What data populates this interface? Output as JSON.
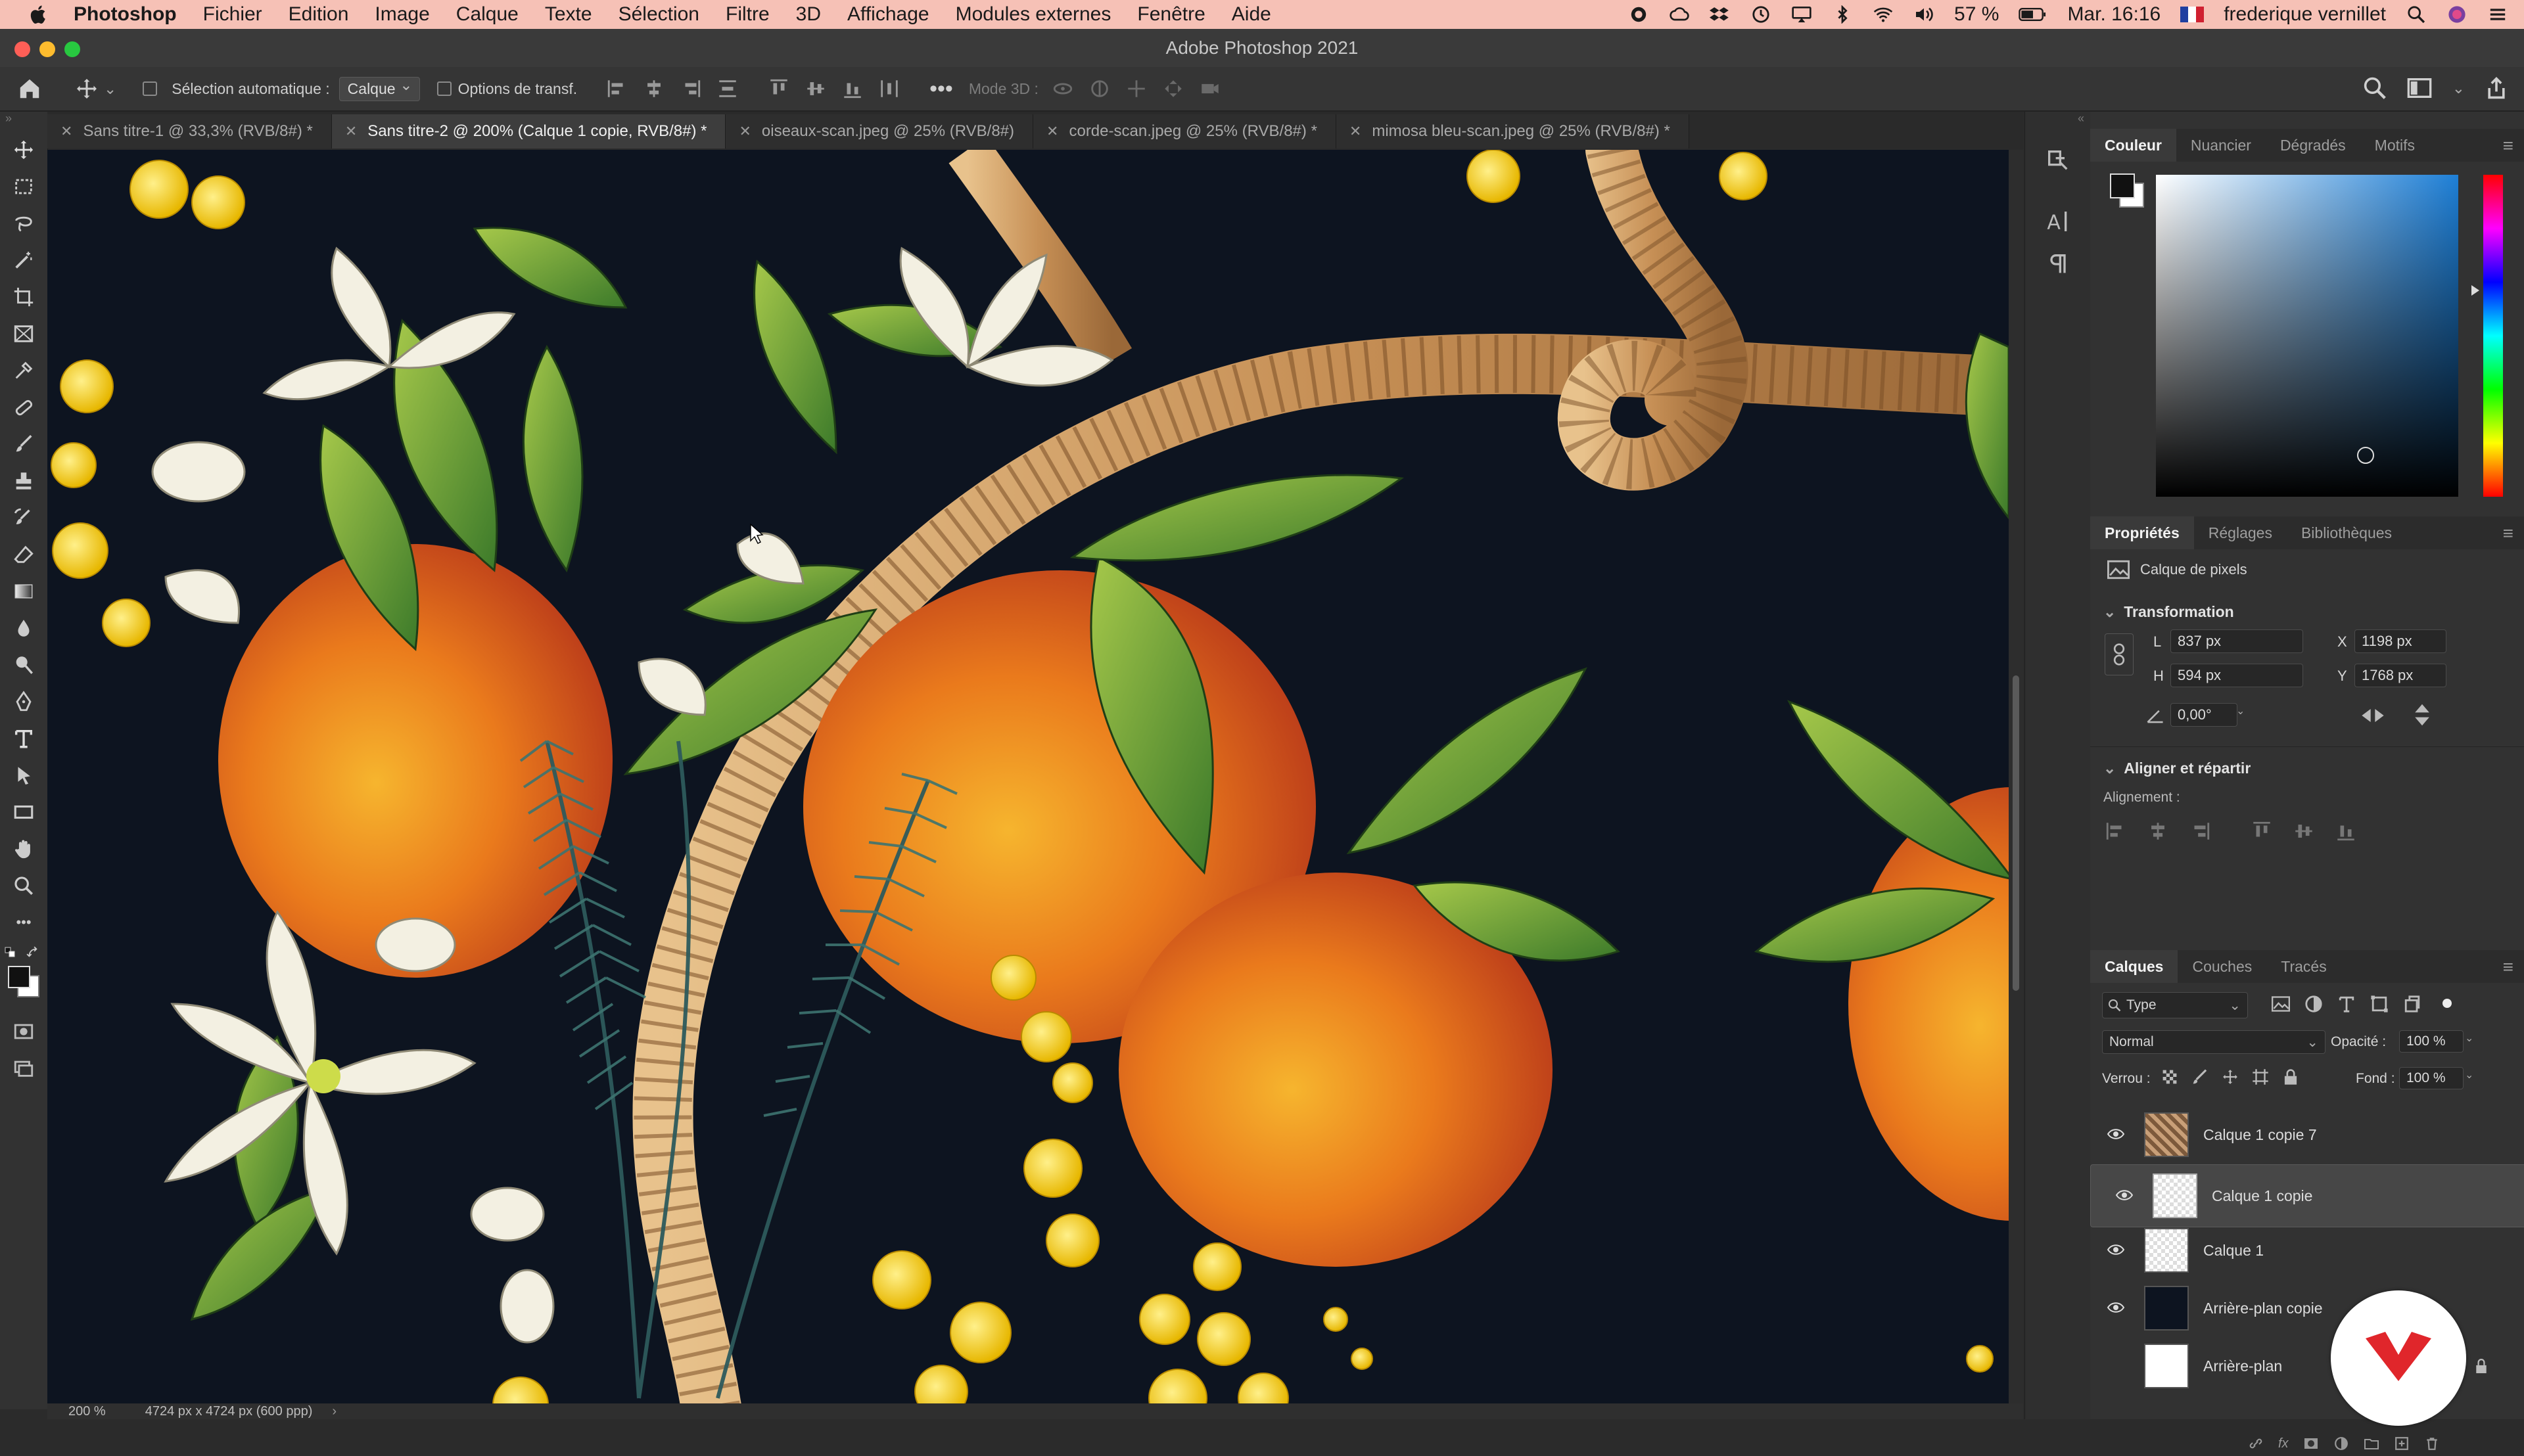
{
  "menubar": {
    "app": "Photoshop",
    "items": [
      "Fichier",
      "Edition",
      "Image",
      "Calque",
      "Texte",
      "Sélection",
      "Filtre",
      "3D",
      "Affichage",
      "Modules externes",
      "Fenêtre",
      "Aide"
    ],
    "battery": "57 %",
    "clock": "Mar. 16:16",
    "user": "frederique vernillet"
  },
  "window": {
    "title": "Adobe Photoshop 2021"
  },
  "options": {
    "auto_select_label": "Sélection automatique :",
    "auto_select_value": "Calque",
    "transform_label": "Options de transf.",
    "mode3d": "Mode 3D :"
  },
  "tabs": [
    {
      "label": "Sans titre-1 @ 33,3% (RVB/8#) *"
    },
    {
      "label": "Sans titre-2 @ 200% (Calque 1 copie, RVB/8#) *"
    },
    {
      "label": "oiseaux-scan.jpeg @ 25% (RVB/8#)"
    },
    {
      "label": "corde-scan.jpeg @ 25% (RVB/8#) *"
    },
    {
      "label": "mimosa bleu-scan.jpeg @ 25% (RVB/8#) *"
    }
  ],
  "status": {
    "zoom": "200 %",
    "doc_size": "4724 px x 4724 px (600 ppp)"
  },
  "color_panel": {
    "tabs": [
      "Couleur",
      "Nuancier",
      "Dégradés",
      "Motifs"
    ]
  },
  "properties": {
    "tabs": [
      "Propriétés",
      "Réglages",
      "Bibliothèques"
    ],
    "layer_kind": "Calque de pixels",
    "transform_title": "Transformation",
    "w_label": "L",
    "w_value": "837 px",
    "h_label": "H",
    "h_value": "594 px",
    "x_label": "X",
    "x_value": "1198 px",
    "y_label": "Y",
    "y_value": "1768 px",
    "angle": "0,00°",
    "align_title": "Aligner et répartir",
    "align_label": "Alignement :"
  },
  "layers_panel": {
    "tabs": [
      "Calques",
      "Couches",
      "Tracés"
    ],
    "filter": "Type",
    "blend_mode": "Normal",
    "opacity_label": "Opacité :",
    "opacity_value": "100 %",
    "lock_label": "Verrou :",
    "fill_label": "Fond :",
    "fill_value": "100 %",
    "layers": [
      {
        "name": "Calque 1 copie 7"
      },
      {
        "name": "Calque 1 copie"
      },
      {
        "name": "Calque 1"
      },
      {
        "name": "Arrière-plan copie"
      },
      {
        "name": "Arrière-plan"
      }
    ]
  },
  "colors": {
    "menubar": "#f6c1b6",
    "canvas_bg": "#0d1420",
    "accent": "#e0262b"
  }
}
